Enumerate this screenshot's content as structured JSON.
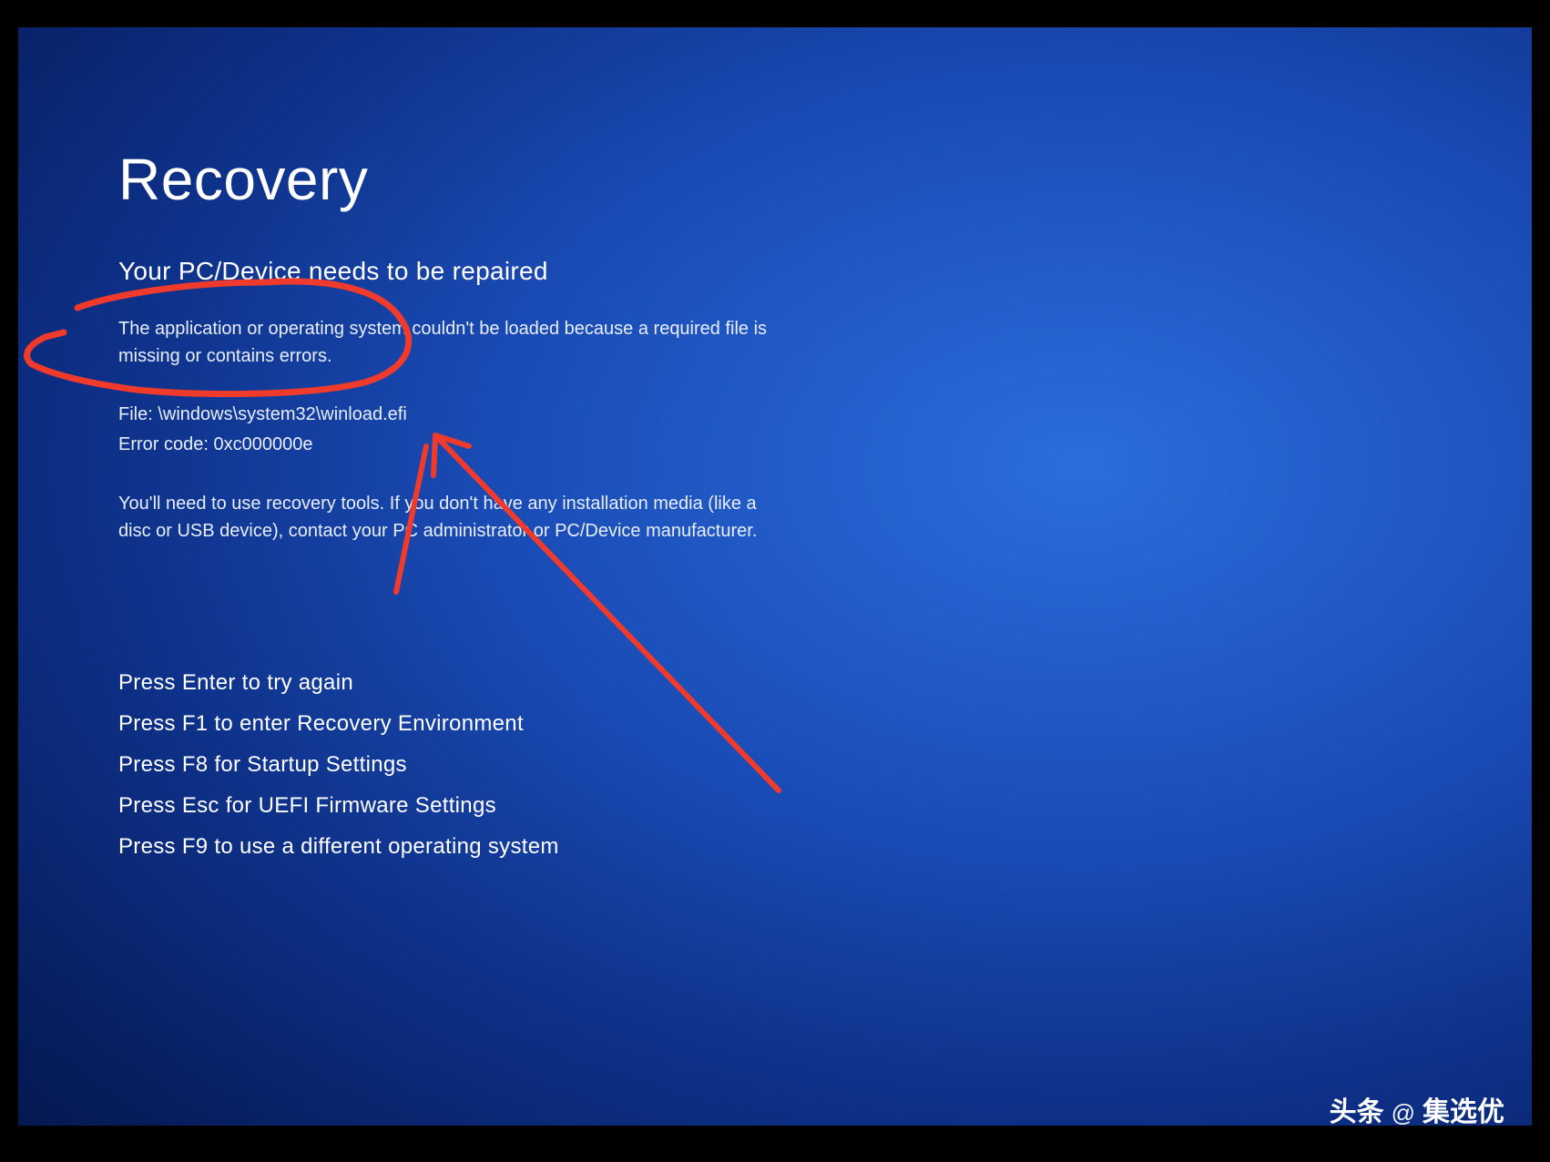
{
  "title": "Recovery",
  "subtitle": "Your PC/Device needs to be repaired",
  "description": "The application or operating system couldn't be loaded because a required file is missing or contains errors.",
  "file_label": "File: ",
  "file_path": "\\windows\\system32\\winload.efi",
  "error_label": "Error code: ",
  "error_code": "0xc000000e",
  "recovery_info": "You'll need to use recovery tools. If you don't have any installation media (like a disc or USB device), contact your PC administrator or PC/Device manufacturer.",
  "options": [
    "Press Enter to try again",
    "Press F1 to enter Recovery Environment",
    "Press F8 for Startup Settings",
    "Press Esc for UEFI Firmware Settings",
    "Press F9 to use a different operating system"
  ],
  "watermark": {
    "brand": "头条",
    "at": "@",
    "author": "集选优"
  }
}
